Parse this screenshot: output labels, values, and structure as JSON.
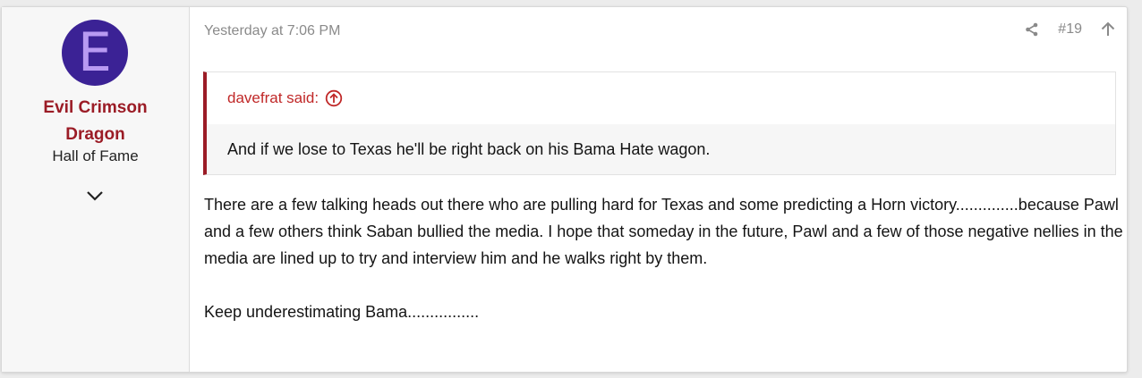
{
  "user": {
    "avatar_letter": "E",
    "avatar_bg": "#3b2295",
    "avatar_fg": "#b89af2",
    "name_line1": "Evil Crimson",
    "name_line2": "Dragon",
    "title": "Hall of Fame",
    "expand_icon": "chevron-down-icon"
  },
  "post": {
    "date": "Yesterday at 7:06 PM",
    "number": "#19",
    "share_icon": "share-icon",
    "up_icon": "arrow-up-icon",
    "quote": {
      "author_label": "davefrat said:",
      "text": "And if we lose to Texas he'll be right back on his Bama Hate wagon."
    },
    "message": {
      "paragraph1": "There are a few talking heads out there who are pulling hard for Texas and some predicting a Horn victory..............because Pawl and a few others think Saban bullied the media. I hope that someday in the future, Pawl and a few of those negative nellies in the media are lined up to try and interview him and he walks right by them.",
      "paragraph2": "Keep underestimating Bama................"
    }
  },
  "colors": {
    "accent": "#9b1c26",
    "quote_link": "#c02828"
  }
}
